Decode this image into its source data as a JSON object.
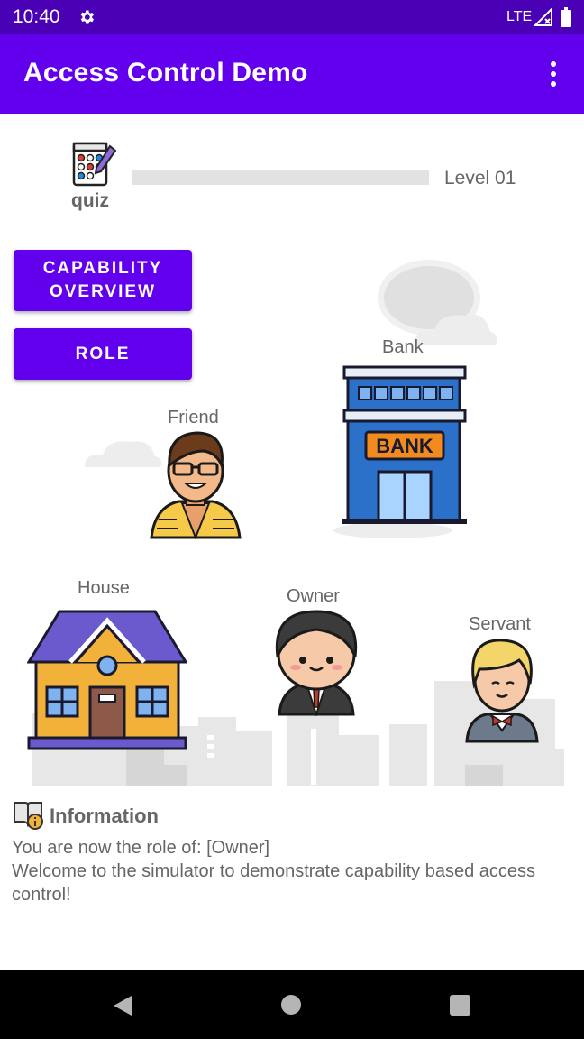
{
  "status_bar": {
    "time": "10:40",
    "network": "LTE"
  },
  "app_bar": {
    "title": "Access Control Demo"
  },
  "quiz": {
    "label": "quiz"
  },
  "level": {
    "label": "Level 01",
    "progress": 0
  },
  "buttons": {
    "capability_overview": "CAPABILITY OVERVIEW",
    "role": "ROLE"
  },
  "scene": {
    "bank_label": "Bank",
    "bank_sign": "BANK",
    "friend_label": "Friend",
    "house_label": "House",
    "owner_label": "Owner",
    "servant_label": "Servant"
  },
  "information": {
    "title": "Information",
    "line1": "You are now the role of: [Owner]",
    "line2": "Welcome to the simulator to demonstrate capability based access control!"
  },
  "colors": {
    "status_bar": "#4a00b4",
    "app_bar": "#6200ee",
    "button": "#6200ee",
    "text_gray": "#666666"
  }
}
